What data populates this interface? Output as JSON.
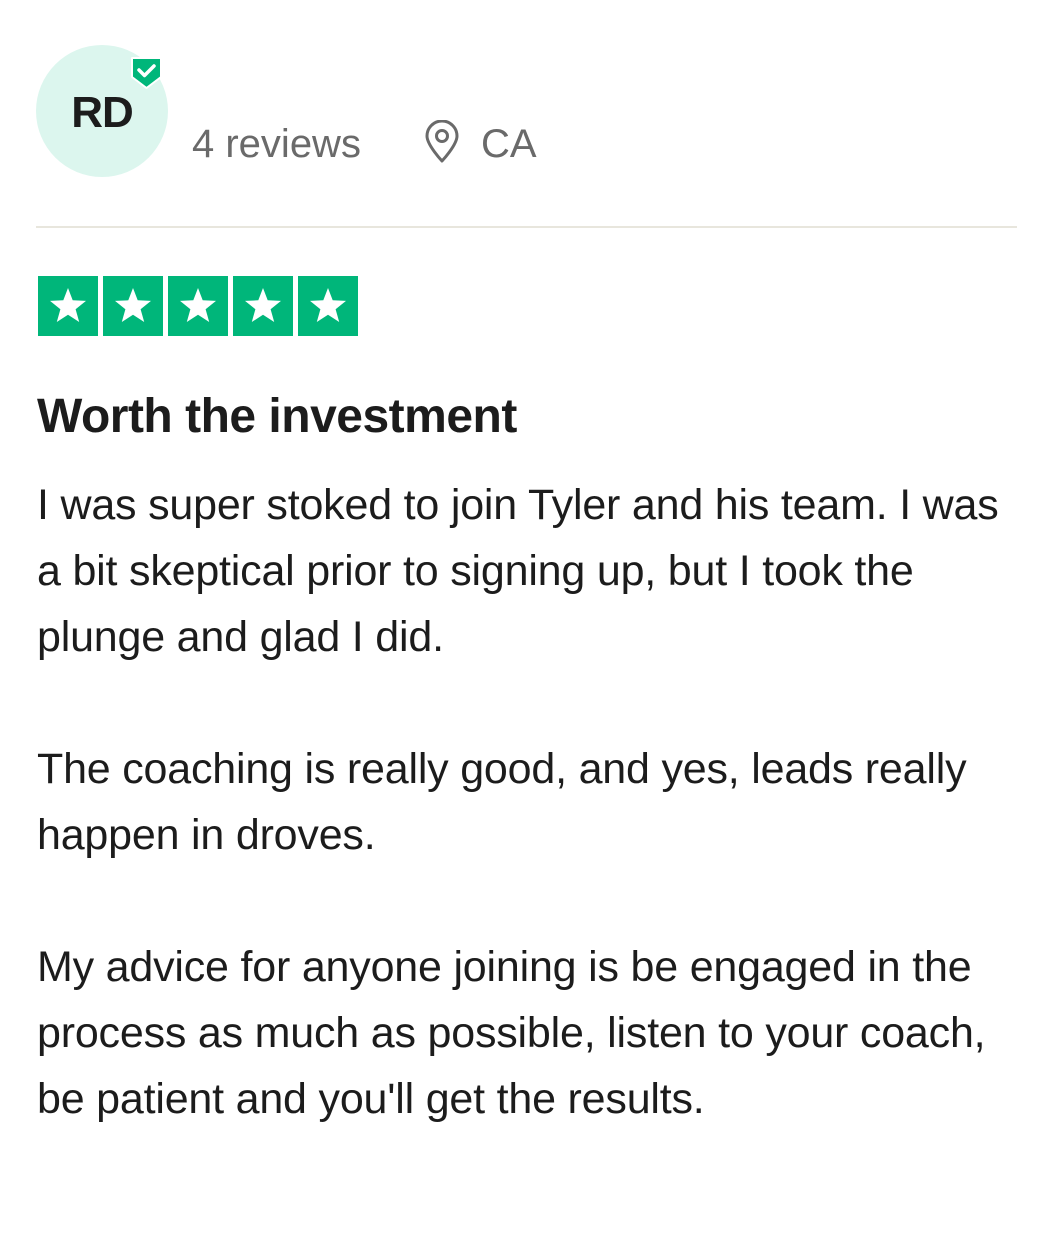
{
  "reviewer": {
    "initials": "RD",
    "reviews_count": "4 reviews",
    "location": "CA",
    "verified": true
  },
  "rating": {
    "stars": 5,
    "max_stars": 5,
    "color": "#00b67a"
  },
  "review": {
    "title": "Worth the investment",
    "paragraphs": [
      "I was super stoked to join Tyler and his team. I was a bit skeptical prior to signing up, but I took the plunge and glad I did.",
      "The coaching is really good, and yes, leads really happen in droves.",
      "My advice for anyone joining is be engaged in the process as much as possible, listen to your coach, be patient and you'll get the results."
    ]
  },
  "colors": {
    "avatar_bg": "#dcf6ee",
    "badge": "#00b67a",
    "muted_text": "#6a6a6a",
    "divider": "#e8e6dd"
  },
  "icons": {
    "verified": "verified-check-icon",
    "location": "location-pin-icon",
    "star": "star-icon"
  }
}
